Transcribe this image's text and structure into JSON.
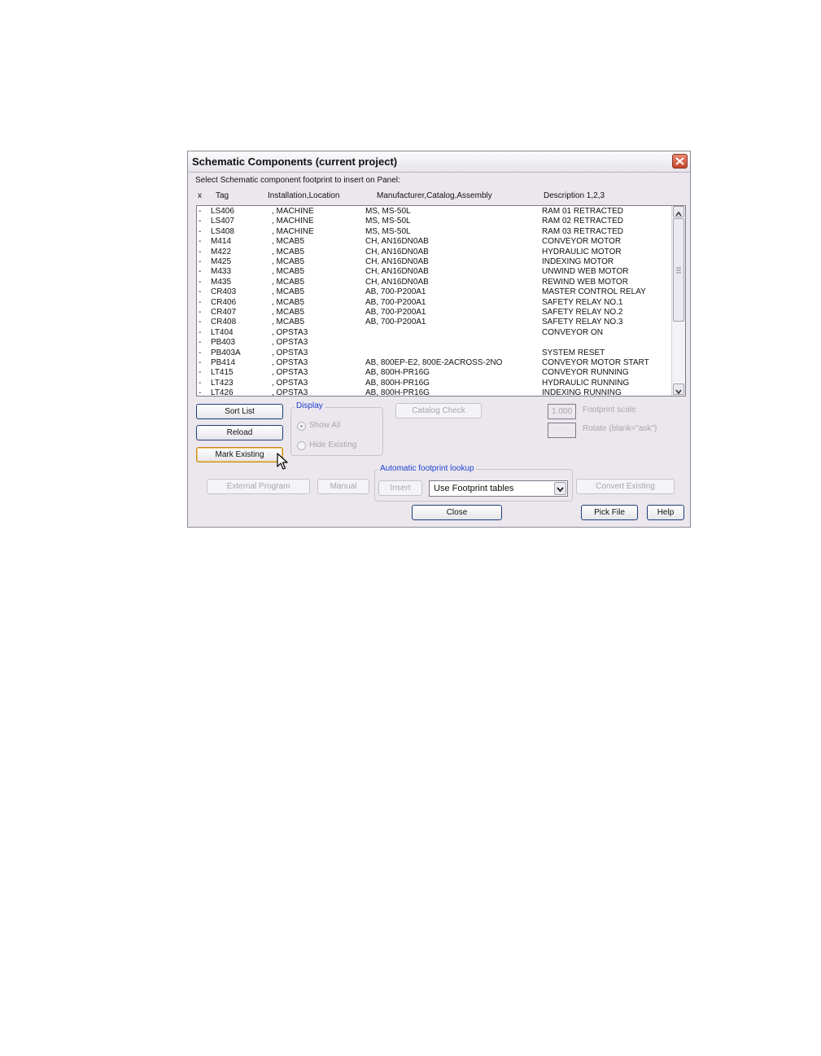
{
  "dialog": {
    "title": "Schematic Components (current project)",
    "instruction": "Select Schematic component footprint to insert on Panel:"
  },
  "columns": {
    "x": "x",
    "tag": "Tag",
    "location": "Installation,Location",
    "manufacturer": "Manufacturer,Catalog,Assembly",
    "description": "Description 1,2,3"
  },
  "rows": [
    {
      "x": "-",
      "tag": "LS406",
      "loc": ", MACHINE",
      "mfr": "MS, MS-50L",
      "desc": "RAM 01 RETRACTED"
    },
    {
      "x": "-",
      "tag": "LS407",
      "loc": ", MACHINE",
      "mfr": "MS, MS-50L",
      "desc": "RAM 02 RETRACTED"
    },
    {
      "x": "-",
      "tag": "LS408",
      "loc": ", MACHINE",
      "mfr": "MS, MS-50L",
      "desc": "RAM 03 RETRACTED"
    },
    {
      "x": "-",
      "tag": "M414",
      "loc": ", MCAB5",
      "mfr": "CH, AN16DN0AB",
      "desc": "CONVEYOR MOTOR"
    },
    {
      "x": "-",
      "tag": "M422",
      "loc": ", MCAB5",
      "mfr": "CH, AN16DN0AB",
      "desc": "HYDRAULIC MOTOR"
    },
    {
      "x": "-",
      "tag": "M425",
      "loc": ", MCAB5",
      "mfr": "CH, AN16DN0AB",
      "desc": "INDEXING MOTOR"
    },
    {
      "x": "-",
      "tag": "M433",
      "loc": ", MCAB5",
      "mfr": "CH, AN16DN0AB",
      "desc": "UNWIND WEB MOTOR"
    },
    {
      "x": "-",
      "tag": "M435",
      "loc": ", MCAB5",
      "mfr": "CH, AN16DN0AB",
      "desc": "REWIND WEB MOTOR"
    },
    {
      "x": "-",
      "tag": "CR403",
      "loc": ", MCAB5",
      "mfr": "AB, 700-P200A1",
      "desc": "MASTER CONTROL RELAY"
    },
    {
      "x": "-",
      "tag": "CR406",
      "loc": ", MCAB5",
      "mfr": "AB, 700-P200A1",
      "desc": "SAFETY RELAY NO.1"
    },
    {
      "x": "-",
      "tag": "CR407",
      "loc": ", MCAB5",
      "mfr": "AB, 700-P200A1",
      "desc": "SAFETY RELAY NO.2"
    },
    {
      "x": "-",
      "tag": "CR408",
      "loc": ", MCAB5",
      "mfr": "AB, 700-P200A1",
      "desc": "SAFETY RELAY NO.3"
    },
    {
      "x": "-",
      "tag": "LT404",
      "loc": ", OPSTA3",
      "mfr": "",
      "desc": "CONVEYOR ON"
    },
    {
      "x": "-",
      "tag": "PB403",
      "loc": ", OPSTA3",
      "mfr": "",
      "desc": ""
    },
    {
      "x": "-",
      "tag": "PB403A",
      "loc": ", OPSTA3",
      "mfr": "",
      "desc": "SYSTEM RESET"
    },
    {
      "x": "-",
      "tag": "PB414",
      "loc": ", OPSTA3",
      "mfr": "AB, 800EP-E2, 800E-2ACROSS-2NO",
      "desc": "CONVEYOR MOTOR START"
    },
    {
      "x": "-",
      "tag": "LT415",
      "loc": ", OPSTA3",
      "mfr": "AB, 800H-PR16G",
      "desc": "CONVEYOR RUNNING"
    },
    {
      "x": "-",
      "tag": "LT423",
      "loc": ", OPSTA3",
      "mfr": "AB, 800H-PR16G",
      "desc": "HYDRAULIC RUNNING"
    },
    {
      "x": "-",
      "tag": "LT426",
      "loc": ", OPSTA3",
      "mfr": "AB, 800H-PR16G",
      "desc": "INDEXING RUNNING"
    }
  ],
  "buttons": {
    "sort_list": "Sort List",
    "reload": "Reload",
    "mark_existing": "Mark Existing",
    "catalog_check": "Catalog Check",
    "external_program": "External Program",
    "manual": "Manual",
    "insert": "Insert",
    "convert_existing": "Convert Existing",
    "close": "Close",
    "pick_file": "Pick File",
    "help": "Help"
  },
  "display_group": {
    "label": "Display",
    "show_all": "Show All",
    "hide_existing": "Hide Existing"
  },
  "footprint": {
    "scale_value": "1.000",
    "scale_label": "Footprint scale",
    "rotate_value": "",
    "rotate_label": "Rotate (blank=\"ask\")"
  },
  "lookup_group": {
    "label": "Automatic footprint lookup",
    "select_value": "Use Footprint tables"
  },
  "icons": {
    "close": "close-icon",
    "scroll_up": "chevron-up-icon",
    "scroll_down": "chevron-down-icon",
    "dropdown": "chevron-down-icon",
    "cursor": "mouse-pointer-icon"
  },
  "colors": {
    "dialog_bg": "#ebe7ed",
    "group_label": "#1f3fd0",
    "close_button": "#c4432a",
    "focus_border": "#c98c1a"
  }
}
